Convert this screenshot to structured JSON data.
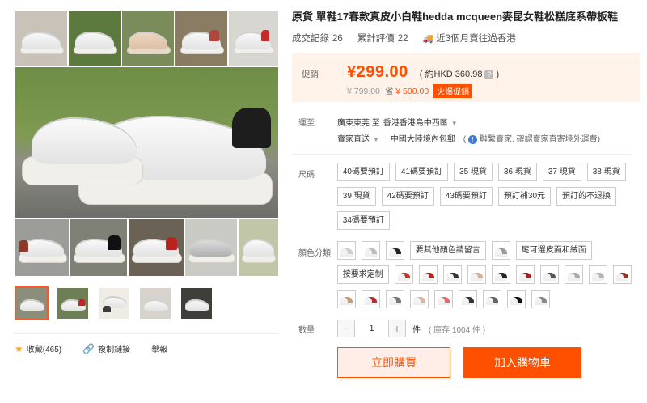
{
  "product": {
    "title": "原貨 單鞋17春款真皮小白鞋hedda mcqueen麥昆女鞋松糕底系帶板鞋",
    "stats": [
      {
        "label": "成交記錄",
        "value": "26"
      },
      {
        "label": "累計評價",
        "value": "22"
      },
      {
        "label": "近3個月賣往過香港",
        "value": ""
      }
    ]
  },
  "price": {
    "promo_label": "促銷",
    "current": "¥299.00",
    "hkd": "( 約HKD 360.98",
    "hkd_close": ")",
    "original": "¥ 799.00",
    "save_prefix": "省",
    "save_amount": "¥ 500.00",
    "hot_badge": "火爆促銷"
  },
  "shipping": {
    "label": "運至",
    "from": "廣東東莞 至",
    "to": "香港香港島中西區",
    "method": "賣家直送",
    "free": "中國大陸境內包郵",
    "note_prefix": "(",
    "note": "聯繫賣家, 確認賣家直寄境外運費)"
  },
  "size": {
    "label": "尺碼",
    "options": [
      "40碼要預訂",
      "41碼要預訂",
      "35 現貨",
      "36 現貨",
      "37 現貨",
      "38 現貨",
      "39 現貨",
      "42碼要預訂",
      "43碼要預訂",
      "預訂補30元",
      "預訂的不退換",
      "34碼要預訂"
    ]
  },
  "color": {
    "label": "顏色分類",
    "text_options": [
      "要其他顏色請留言",
      "尾可選皮面和絨面",
      "按要求定制"
    ]
  },
  "quantity": {
    "label": "數量",
    "minus": "−",
    "value": "1",
    "plus": "+",
    "unit": "件",
    "stock": "( 庫存 1004 件 )"
  },
  "buttons": {
    "buy_now": "立即購買",
    "add_to_cart": "加入購物車"
  },
  "actions": {
    "favorite": "收藏(465)",
    "copy_link": "複制鏈接",
    "report": "舉報"
  },
  "colors": {
    "accent": "#ff5000",
    "price": "#ff4e00",
    "price_bg": "#fff2e8"
  }
}
